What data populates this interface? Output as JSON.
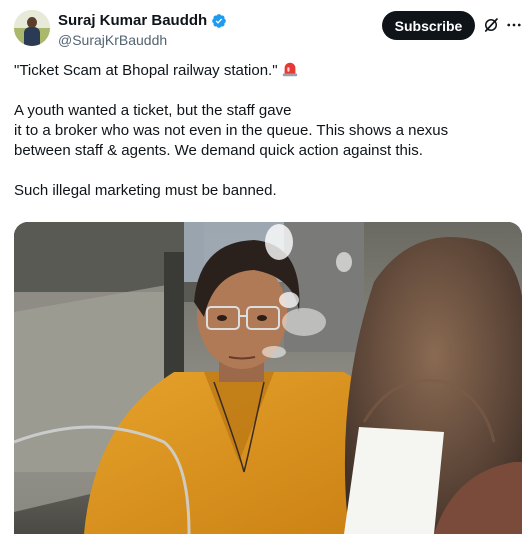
{
  "author": {
    "display_name": "Suraj Kumar Bauddh",
    "handle": "@SurajKrBauddh",
    "verified_icon": "verified-badge-icon"
  },
  "actions": {
    "subscribe_label": "Subscribe",
    "grok_icon": "grok-icon",
    "more_icon": "more-options-icon"
  },
  "tweet": {
    "line1": "\"Ticket Scam at Bhopal railway station.\"",
    "emoji": "police-car-light-icon",
    "para2_line1": "A youth wanted a ticket, but the staff gave",
    "para2_line2": "it to a broker who was not even in the queue. This shows a nexus",
    "para2_line3": "between staff & agents. We demand quick action against this.",
    "para3": "Such illegal marketing must be banned."
  },
  "media": {
    "alt": "video-still-ticket-counter"
  },
  "colors": {
    "text": "#0f1419",
    "secondary": "#536471",
    "verified_blue": "#1d9bf0",
    "button_bg": "#0f1419",
    "saree_orange": "#d8921e"
  }
}
